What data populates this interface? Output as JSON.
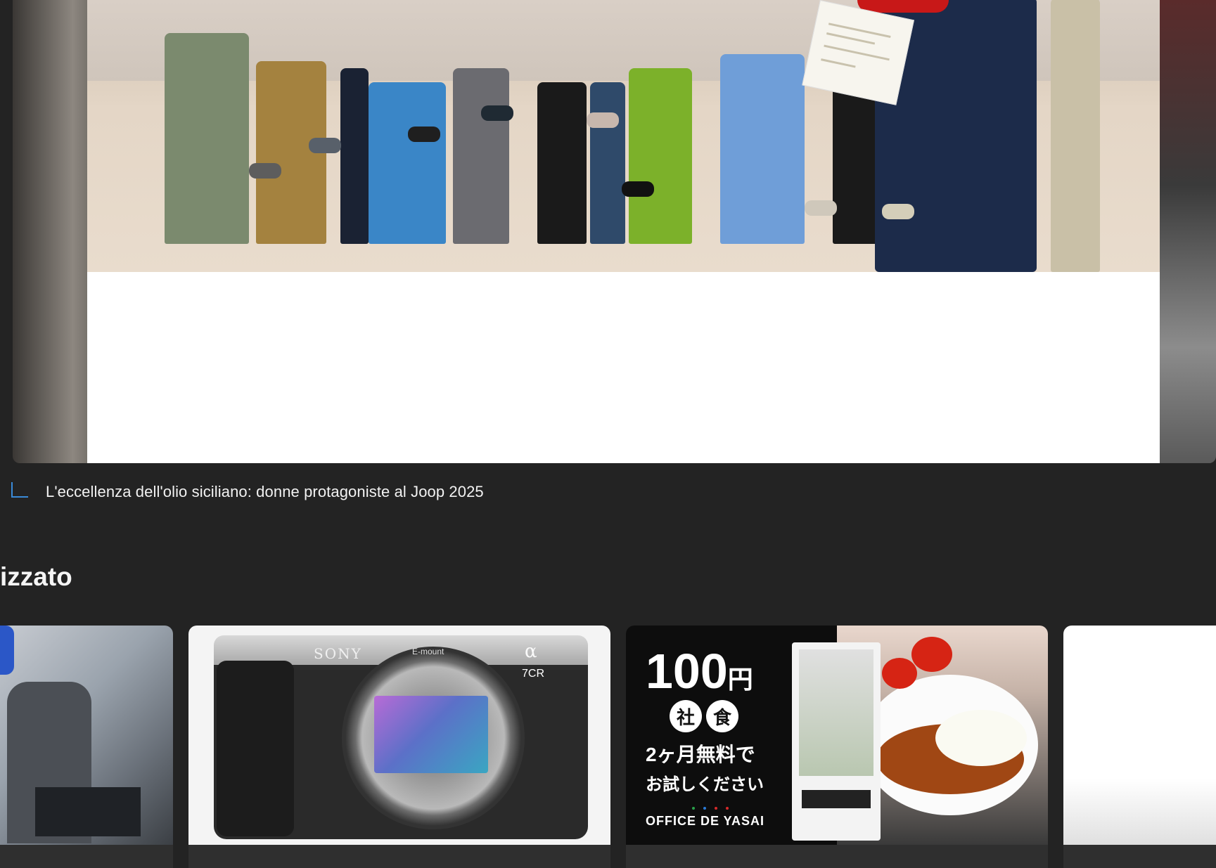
{
  "article": {
    "caption": "L'eccellenza dell'olio siciliano: donne protagoniste al Joop 2025"
  },
  "section": {
    "title": "izzato"
  },
  "cards": [
    {
      "name": "news-card-partial"
    },
    {
      "name": "sony-camera-ad",
      "brand": "SONY",
      "mount": "E-mount",
      "alpha": "α",
      "model": "7CR"
    },
    {
      "name": "office-de-yasai-ad",
      "price": "100",
      "yen": "円",
      "badge1": "社",
      "badge2": "食",
      "line2": "2ヶ月無料で",
      "line3": "お試しください",
      "logo": "OFFICE DE YASAI"
    },
    {
      "name": "blank-card-partial"
    }
  ],
  "colors": {
    "background": "#232323",
    "accent": "#3a8ad8"
  }
}
